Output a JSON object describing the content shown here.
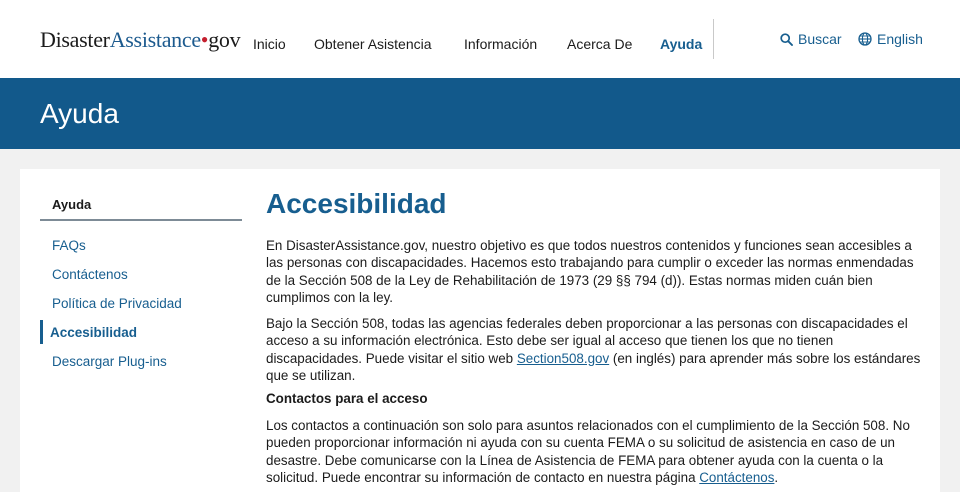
{
  "header": {
    "logo": {
      "part1": "Disaster",
      "part2": "Assistance",
      "dot": "•",
      "part3": "gov"
    },
    "nav": [
      {
        "label": "Inicio",
        "active": false
      },
      {
        "label": "Obtener Asistencia",
        "active": false
      },
      {
        "label": "Información",
        "active": false
      },
      {
        "label": "Acerca De",
        "active": false
      },
      {
        "label": "Ayuda",
        "active": true
      }
    ],
    "search_label": "Buscar",
    "language_label": "English"
  },
  "banner": {
    "title": "Ayuda"
  },
  "sidebar": {
    "title": "Ayuda",
    "items": [
      {
        "label": "FAQs",
        "active": false
      },
      {
        "label": "Contáctenos",
        "active": false
      },
      {
        "label": "Política de Privacidad",
        "active": false
      },
      {
        "label": "Accesibilidad",
        "active": true
      },
      {
        "label": "Descargar Plug-ins",
        "active": false
      }
    ]
  },
  "main": {
    "title": "Accesibilidad",
    "p1": "En DisasterAssistance.gov, nuestro objetivo es que todos nuestros contenidos y funciones sean accesibles a las personas con discapacidades. Hacemos esto trabajando para cumplir o exceder las normas enmendadas de la Sección 508 de la Ley de Rehabilitación de 1973 (29 §§ 794 (d)). Estas normas miden cuán bien cumplimos con la ley.",
    "p2_before": "Bajo la Sección 508, todas las agencias federales deben proporcionar a las personas con discapacidades el acceso a su información electrónica. Esto debe ser igual al acceso que tienen los que no tienen discapacidades. Puede visitar el sitio web ",
    "p2_link": "Section508.gov",
    "p2_after": " (en inglés) para aprender más sobre los estándares que se utilizan.",
    "subheading": "Contactos para el acceso",
    "p3_before": "Los contactos a continuación son solo para asuntos relacionados con el cumplimiento de la Sección 508. No pueden proporcionar información ni ayuda con su cuenta FEMA o su solicitud de asistencia en caso de un desastre. Debe comunicarse con la Línea de Asistencia de FEMA para obtener ayuda con la cuenta o la solicitud. Puede encontrar su información de contacto en nuestra página ",
    "p3_link": "Contáctenos",
    "p3_after": "."
  },
  "colors": {
    "brand_blue": "#12598b",
    "link_blue": "#175e8f",
    "logo_dot_red": "#c41f2e"
  }
}
